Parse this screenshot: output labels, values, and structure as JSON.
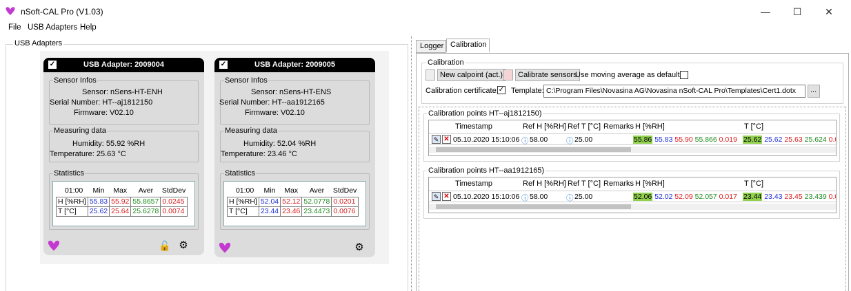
{
  "window": {
    "title": "nSoft-CAL Pro (V1.03)",
    "minimize": "—",
    "maximize": "☐",
    "close": "✕"
  },
  "menu": [
    "File",
    "USB Adapters",
    "Help"
  ],
  "left_panel": {
    "legend": "USB Adapters"
  },
  "adapters": [
    {
      "header": "USB Adapter: 2009004",
      "checked": true,
      "sensor_legend": "Sensor Infos",
      "sensor": "Sensor: nSens-HT-ENH",
      "serial": "Serial Number: HT--aj1812150",
      "firmware": "Firmware: V02.10",
      "measuring_legend": "Measuring data",
      "humidity": "Humidity: 55.92 %RH",
      "temperature": "Temperature: 25.63 °C",
      "stats_legend": "Statistics",
      "stats_header": [
        "01:00",
        "Min",
        "Max",
        "Aver",
        "StdDev"
      ],
      "stats_rows": [
        {
          "label": "H [%RH]",
          "min": "55.83",
          "max": "55.92",
          "aver": "55.8657",
          "std": "0.0245"
        },
        {
          "label": "T [°C]",
          "min": "25.62",
          "max": "25.64",
          "aver": "25.6278",
          "std": "0.0074"
        }
      ]
    },
    {
      "header": "USB Adapter: 2009005",
      "checked": true,
      "sensor_legend": "Sensor Infos",
      "sensor": "Sensor: nSens-HT-ENS",
      "serial": "Serial Number: HT--aa1912165",
      "firmware": "Firmware: V02.10",
      "measuring_legend": "Measuring data",
      "humidity": "Humidity: 52.04 %RH",
      "temperature": "Temperature: 23.46 °C",
      "stats_legend": "Statistics",
      "stats_header": [
        "01:00",
        "Min",
        "Max",
        "Aver",
        "StdDev"
      ],
      "stats_rows": [
        {
          "label": "H [%RH]",
          "min": "52.04",
          "max": "52.12",
          "aver": "52.0778",
          "std": "0.0201"
        },
        {
          "label": "T [°C]",
          "min": "23.44",
          "max": "23.46",
          "aver": "23.4473",
          "std": "0.0076"
        }
      ]
    }
  ],
  "tabs": [
    "Logger",
    "Calibration"
  ],
  "calibration": {
    "legend": "Calibration",
    "new_calpoint": "New calpoint (act.)",
    "calibrate_sensors": "Calibrate sensors",
    "moving_avg_label": "Use moving average as default:",
    "cert_label": "Calibration certificate:",
    "template_label": "Template:",
    "template_path": "C:\\Program Files\\Novasina AG\\Novasina nSoft-CAL Pro\\Templates\\Cert1.dotx",
    "browse": "..."
  },
  "calpoint_headers": [
    "Timestamp",
    "Ref H [%RH]",
    "Ref T [°C]",
    "Remarks",
    "H [%RH]",
    "T [°C]"
  ],
  "calpoint_groups": [
    {
      "legend": "Calibration points HT--aj1812150)",
      "timestamp": "05.10.2020 15:10:06",
      "ref_h": "58.00",
      "ref_t": "25.00",
      "h_vals": [
        "55.86",
        "55.83",
        "55.90",
        "55.866",
        "0.019"
      ],
      "t_vals": [
        "25.62",
        "25.62",
        "25.63",
        "25.624",
        "0.0"
      ]
    },
    {
      "legend": "Calibration points HT--aa1912165)",
      "timestamp": "05.10.2020 15:10:06",
      "ref_h": "58.00",
      "ref_t": "25.00",
      "h_vals": [
        "52.06",
        "52.02",
        "52.09",
        "52.057",
        "0.017"
      ],
      "t_vals": [
        "23.44",
        "23.43",
        "23.45",
        "23.439",
        "0.0"
      ]
    }
  ]
}
